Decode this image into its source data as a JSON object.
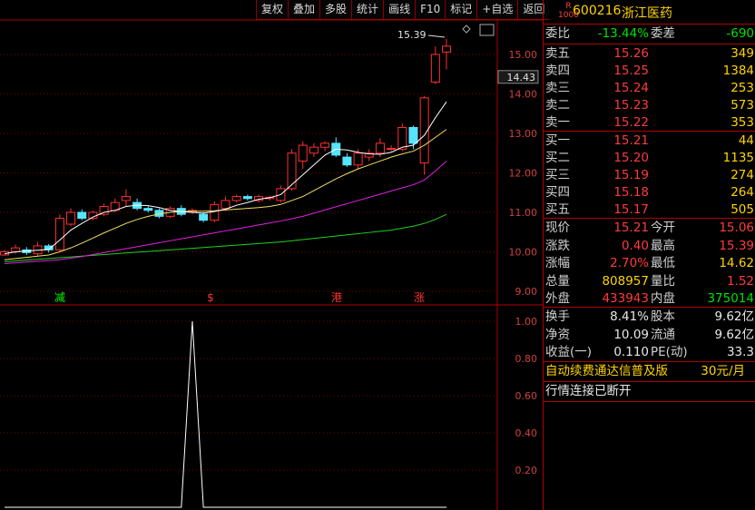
{
  "toolbar": {
    "items": [
      "复权",
      "叠加",
      "多股",
      "统计",
      "画线",
      "F10",
      "标记",
      "+自选",
      "返回"
    ]
  },
  "main_chart": {
    "price_axis": [
      "15.00",
      "14.00",
      "13.00",
      "12.00",
      "11.00",
      "10.00",
      "9.00"
    ],
    "current_price_label": "14.43",
    "high_annotation": "15.39",
    "event_labels": [
      {
        "text": "减",
        "color": "#00ff00"
      },
      {
        "text": "$",
        "color": "#ff3333"
      },
      {
        "text": "港",
        "color": "#ff3333"
      },
      {
        "text": "涨",
        "color": "#ff3333"
      }
    ],
    "candles": [
      {
        "o": 9.92,
        "c": 10.0,
        "h": 10.05,
        "l": 9.9
      },
      {
        "o": 10.0,
        "c": 10.1,
        "h": 10.18,
        "l": 9.95
      },
      {
        "o": 10.05,
        "c": 9.98,
        "h": 10.12,
        "l": 9.92
      },
      {
        "o": 9.95,
        "c": 10.15,
        "h": 10.25,
        "l": 9.9
      },
      {
        "o": 10.15,
        "c": 10.05,
        "h": 10.2,
        "l": 9.98
      },
      {
        "o": 10.05,
        "c": 10.85,
        "h": 10.95,
        "l": 10.0
      },
      {
        "o": 10.7,
        "c": 11.0,
        "h": 11.1,
        "l": 10.65
      },
      {
        "o": 11.0,
        "c": 10.85,
        "h": 11.08,
        "l": 10.8
      },
      {
        "o": 10.85,
        "c": 11.0,
        "h": 11.05,
        "l": 10.8
      },
      {
        "o": 10.95,
        "c": 11.15,
        "h": 11.22,
        "l": 10.9
      },
      {
        "o": 11.05,
        "c": 11.25,
        "h": 11.35,
        "l": 11.0
      },
      {
        "o": 11.3,
        "c": 11.4,
        "h": 11.58,
        "l": 11.15
      },
      {
        "o": 11.25,
        "c": 11.1,
        "h": 11.35,
        "l": 11.05
      },
      {
        "o": 11.1,
        "c": 11.05,
        "h": 11.15,
        "l": 11.0
      },
      {
        "o": 11.05,
        "c": 10.9,
        "h": 11.1,
        "l": 10.85
      },
      {
        "o": 10.9,
        "c": 11.1,
        "h": 11.15,
        "l": 10.85
      },
      {
        "o": 11.1,
        "c": 10.95,
        "h": 11.18,
        "l": 10.9
      },
      {
        "o": 11.0,
        "c": 11.05,
        "h": 11.1,
        "l": 10.95
      },
      {
        "o": 10.95,
        "c": 10.8,
        "h": 11.0,
        "l": 10.75
      },
      {
        "o": 10.8,
        "c": 11.2,
        "h": 11.28,
        "l": 10.75
      },
      {
        "o": 11.1,
        "c": 11.3,
        "h": 11.4,
        "l": 11.05
      },
      {
        "o": 11.3,
        "c": 11.4,
        "h": 11.45,
        "l": 11.25
      },
      {
        "o": 11.4,
        "c": 11.35,
        "h": 11.45,
        "l": 11.3
      },
      {
        "o": 11.3,
        "c": 11.4,
        "h": 11.45,
        "l": 11.25
      },
      {
        "o": 11.35,
        "c": 11.38,
        "h": 11.42,
        "l": 11.3
      },
      {
        "o": 11.3,
        "c": 11.6,
        "h": 11.68,
        "l": 11.25
      },
      {
        "o": 11.6,
        "c": 12.5,
        "h": 12.6,
        "l": 11.55
      },
      {
        "o": 12.3,
        "c": 12.7,
        "h": 12.8,
        "l": 12.1
      },
      {
        "o": 12.5,
        "c": 12.65,
        "h": 12.75,
        "l": 12.4
      },
      {
        "o": 12.65,
        "c": 12.75,
        "h": 12.8,
        "l": 12.55
      },
      {
        "o": 12.75,
        "c": 12.45,
        "h": 12.9,
        "l": 12.4
      },
      {
        "o": 12.4,
        "c": 12.2,
        "h": 12.5,
        "l": 12.15
      },
      {
        "o": 12.2,
        "c": 12.5,
        "h": 12.6,
        "l": 12.1
      },
      {
        "o": 12.4,
        "c": 12.5,
        "h": 12.6,
        "l": 12.3
      },
      {
        "o": 12.5,
        "c": 12.75,
        "h": 12.88,
        "l": 12.4
      },
      {
        "o": 12.62,
        "c": 12.62,
        "h": 12.7,
        "l": 12.55
      },
      {
        "o": 12.6,
        "c": 13.15,
        "h": 13.25,
        "l": 12.55
      },
      {
        "o": 13.15,
        "c": 12.75,
        "h": 13.2,
        "l": 12.6
      },
      {
        "o": 12.25,
        "c": 13.9,
        "h": 13.95,
        "l": 11.95
      },
      {
        "o": 14.3,
        "c": 15.0,
        "h": 15.2,
        "l": 14.25
      },
      {
        "o": 15.06,
        "c": 15.21,
        "h": 15.39,
        "l": 14.62
      }
    ],
    "ma5": [
      9.95,
      10.0,
      10.02,
      10.04,
      10.06,
      10.3,
      10.55,
      10.72,
      10.88,
      11.0,
      11.05,
      11.15,
      11.18,
      11.17,
      11.12,
      11.05,
      11.02,
      11.0,
      10.98,
      11.02,
      11.08,
      11.18,
      11.25,
      11.33,
      11.37,
      11.45,
      11.7,
      11.95,
      12.2,
      12.45,
      12.6,
      12.58,
      12.52,
      12.48,
      12.47,
      12.52,
      12.65,
      12.7,
      12.95,
      13.4,
      13.8
    ],
    "ma10": [
      9.8,
      9.83,
      9.86,
      9.89,
      9.92,
      10.0,
      10.1,
      10.22,
      10.35,
      10.48,
      10.6,
      10.72,
      10.82,
      10.9,
      10.96,
      11.0,
      11.02,
      11.03,
      11.03,
      11.04,
      11.06,
      11.08,
      11.1,
      11.12,
      11.15,
      11.2,
      11.3,
      11.4,
      11.55,
      11.7,
      11.85,
      11.98,
      12.1,
      12.2,
      12.3,
      12.4,
      12.48,
      12.55,
      12.7,
      12.9,
      13.1
    ],
    "ma20": [
      9.7,
      9.72,
      9.74,
      9.76,
      9.78,
      9.8,
      9.84,
      9.88,
      9.93,
      9.98,
      10.03,
      10.08,
      10.13,
      10.18,
      10.23,
      10.28,
      10.33,
      10.38,
      10.43,
      10.48,
      10.53,
      10.58,
      10.63,
      10.68,
      10.73,
      10.78,
      10.84,
      10.9,
      10.98,
      11.06,
      11.14,
      11.22,
      11.3,
      11.38,
      11.46,
      11.54,
      11.62,
      11.7,
      11.82,
      12.05,
      12.3
    ],
    "ma60": [
      9.75,
      9.77,
      9.79,
      9.81,
      9.83,
      9.85,
      9.87,
      9.89,
      9.91,
      9.93,
      9.95,
      9.97,
      9.99,
      10.01,
      10.03,
      10.05,
      10.07,
      10.09,
      10.11,
      10.13,
      10.15,
      10.17,
      10.19,
      10.21,
      10.23,
      10.25,
      10.28,
      10.31,
      10.34,
      10.37,
      10.4,
      10.43,
      10.46,
      10.49,
      10.52,
      10.55,
      10.6,
      10.65,
      10.72,
      10.82,
      10.95
    ]
  },
  "sub_chart": {
    "axis": [
      "1.00",
      "0.80",
      "0.60",
      "0.40",
      "0.20"
    ],
    "values": [
      0,
      0,
      0,
      0,
      0,
      0,
      0,
      0,
      0,
      0,
      0,
      0,
      0,
      0,
      0,
      0,
      0,
      1,
      0,
      0,
      0,
      0,
      0,
      0,
      0,
      0,
      0,
      0,
      0,
      0,
      0,
      0,
      0,
      0,
      0,
      0,
      0,
      0,
      0,
      0,
      0
    ]
  },
  "quote": {
    "code": "600216",
    "name": "浙江医药",
    "weibi_label": "委比",
    "weibi_value": "-13.44%",
    "weicha_label": "委差",
    "weicha_value": "-690",
    "sell": [
      {
        "label": "卖五",
        "price": "15.26",
        "vol": "349"
      },
      {
        "label": "卖四",
        "price": "15.25",
        "vol": "1384"
      },
      {
        "label": "卖三",
        "price": "15.24",
        "vol": "253"
      },
      {
        "label": "卖二",
        "price": "15.23",
        "vol": "573"
      },
      {
        "label": "卖一",
        "price": "15.22",
        "vol": "353"
      }
    ],
    "buy": [
      {
        "label": "买一",
        "price": "15.21",
        "vol": "44"
      },
      {
        "label": "买二",
        "price": "15.20",
        "vol": "1135"
      },
      {
        "label": "买三",
        "price": "15.19",
        "vol": "274"
      },
      {
        "label": "买四",
        "price": "15.18",
        "vol": "264"
      },
      {
        "label": "买五",
        "price": "15.17",
        "vol": "505"
      }
    ],
    "stats": [
      {
        "l1": "现价",
        "v1": "15.21",
        "c1": "red",
        "l2": "今开",
        "v2": "15.06",
        "c2": "red"
      },
      {
        "l1": "涨跌",
        "v1": "0.40",
        "c1": "red",
        "l2": "最高",
        "v2": "15.39",
        "c2": "red"
      },
      {
        "l1": "涨幅",
        "v1": "2.70%",
        "c1": "red",
        "l2": "最低",
        "v2": "14.62",
        "c2": "yellow"
      },
      {
        "l1": "总量",
        "v1": "808957",
        "c1": "yellow",
        "l2": "量比",
        "v2": "1.52",
        "c2": "red"
      },
      {
        "l1": "外盘",
        "v1": "433943",
        "c1": "red",
        "l2": "内盘",
        "v2": "375014",
        "c2": "green"
      }
    ],
    "stats2": [
      {
        "l1": "换手",
        "v1": "8.41%",
        "l2": "股本",
        "v2": "9.62亿"
      },
      {
        "l1": "净资",
        "v1": "10.09",
        "l2": "流通",
        "v2": "9.62亿"
      },
      {
        "l1": "收益(一)",
        "v1": "0.110",
        "l2": "PE(动)",
        "v2": "33.3"
      }
    ],
    "promo": "自动续费通达信普及版",
    "promo_price": "30元/月",
    "status": "行情连接已断开"
  }
}
